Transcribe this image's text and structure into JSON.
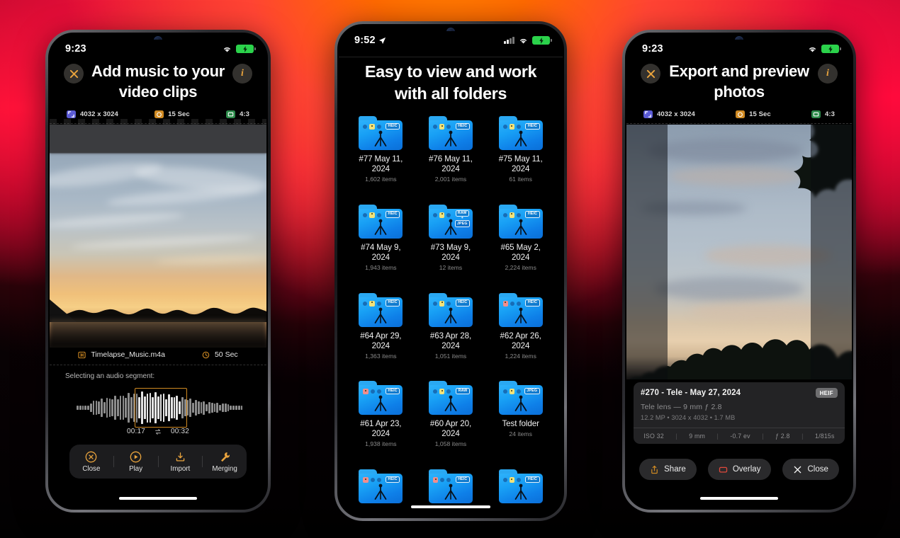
{
  "background": {
    "top_accent": "#ff7a00",
    "edge_accent": "#f0123c",
    "bottom": "#050103"
  },
  "phone1": {
    "statusbar": {
      "time": "9:23",
      "wifi_icon": "wifi-icon",
      "battery_icon": "battery-charging-icon"
    },
    "header": {
      "title": "Add music to your video clips",
      "close_icon": "close-x-icon",
      "info_icon": "info-circle-icon"
    },
    "meta": [
      {
        "icon": "resolution-icon",
        "label": "4032 x 3024",
        "color": "#5b5bd6"
      },
      {
        "icon": "timer-icon",
        "label": "15 Sec",
        "color": "#d08a22"
      },
      {
        "icon": "aspect-ratio-icon",
        "label": "4:3",
        "color": "#2c8a4a"
      }
    ],
    "audio": {
      "file_icon": "music-file-icon",
      "file_name": "Timelapse_Music.m4a",
      "duration_icon": "clock-icon",
      "duration": "50 Sec",
      "segment_label": "Selecting an audio segment:",
      "start_time": "00:17",
      "swap_icon": "swap-icon",
      "end_time": "00:32",
      "selection_color": "#d08a22"
    },
    "toolbar": [
      {
        "icon": "close-circle-icon",
        "label": "Close"
      },
      {
        "icon": "play-circle-icon",
        "label": "Play"
      },
      {
        "icon": "import-icon",
        "label": "Import"
      },
      {
        "icon": "wrench-icon",
        "label": "Merging"
      }
    ]
  },
  "phone2": {
    "statusbar": {
      "time": "9:52",
      "location_icon": "location-arrow-icon",
      "signal_icon": "cellular-signal-icon",
      "wifi_icon": "wifi-icon",
      "battery_icon": "battery-charging-icon"
    },
    "title": "Easy to view and work with all folders",
    "folders": [
      {
        "name": "#77 May 11, 2024",
        "count": "1,602 items",
        "format": "HEIC",
        "key": "yellow"
      },
      {
        "name": "#76 May 11, 2024",
        "count": "2,001 items",
        "format": "HEIC",
        "key": "yellow"
      },
      {
        "name": "#75 May 11, 2024",
        "count": "61 items",
        "format": "HEIC",
        "key": "yellow"
      },
      {
        "name": "#74 May 9, 2024",
        "count": "1,943 items",
        "format": "HEIC",
        "key": "yellow"
      },
      {
        "name": "#73 May 9, 2024",
        "count": "12 items",
        "format": "RAW + JPEG",
        "key": "yellow"
      },
      {
        "name": "#65 May 2, 2024",
        "count": "2,224 items",
        "format": "HEIC",
        "key": "yellow"
      },
      {
        "name": "#64 Apr 29, 2024",
        "count": "1,363 items",
        "format": "HEIC",
        "key": "yellow"
      },
      {
        "name": "#63 Apr 28, 2024",
        "count": "1,051 items",
        "format": "HEIC",
        "key": "yellow"
      },
      {
        "name": "#62 Apr 26, 2024",
        "count": "1,224 items",
        "format": "HEIC",
        "key": "red"
      },
      {
        "name": "#61 Apr 23, 2024",
        "count": "1,938 items",
        "format": "HEIC",
        "key": "red"
      },
      {
        "name": "#60 Apr 20, 2024",
        "count": "1,058 items",
        "format": "RAW",
        "key": "yellow"
      },
      {
        "name": "Test folder",
        "count": "24 items",
        "format": "JPEG",
        "key": "yellow"
      },
      {
        "name": "",
        "count": "",
        "format": "HEIC",
        "key": "red"
      },
      {
        "name": "",
        "count": "",
        "format": "HEIC",
        "key": "red"
      },
      {
        "name": "",
        "count": "",
        "format": "HEIC",
        "key": "yellow"
      }
    ]
  },
  "phone3": {
    "statusbar": {
      "time": "9:23",
      "wifi_icon": "wifi-icon",
      "battery_icon": "battery-charging-icon"
    },
    "header": {
      "title": "Export and preview photos",
      "close_icon": "close-x-icon",
      "info_icon": "info-circle-icon"
    },
    "meta": [
      {
        "icon": "resolution-icon",
        "label": "4032 x 3024",
        "color": "#5b5bd6"
      },
      {
        "icon": "timer-icon",
        "label": "15 Sec",
        "color": "#d08a22"
      },
      {
        "icon": "aspect-ratio-icon",
        "label": "4:3",
        "color": "#2c8a4a"
      }
    ],
    "exif": {
      "title": "#270 - Tele - May 27, 2024",
      "format_badge": "HEIF",
      "lens_line": "Tele lens — 9 mm ƒ 2.8",
      "detail_line": "12.2 MP  •  3024 x 4032  •  1.7 MB",
      "footer": [
        "ISO 32",
        "9 mm",
        "-0.7 ev",
        "ƒ 2.8",
        "1/815s"
      ]
    },
    "toolbar": [
      {
        "icon": "share-icon",
        "label": "Share",
        "color": "#d08a22"
      },
      {
        "icon": "overlay-rect-icon",
        "label": "Overlay",
        "color": "#e0493c"
      },
      {
        "icon": "close-x-icon",
        "label": "Close",
        "color": "#ffffff"
      }
    ]
  }
}
